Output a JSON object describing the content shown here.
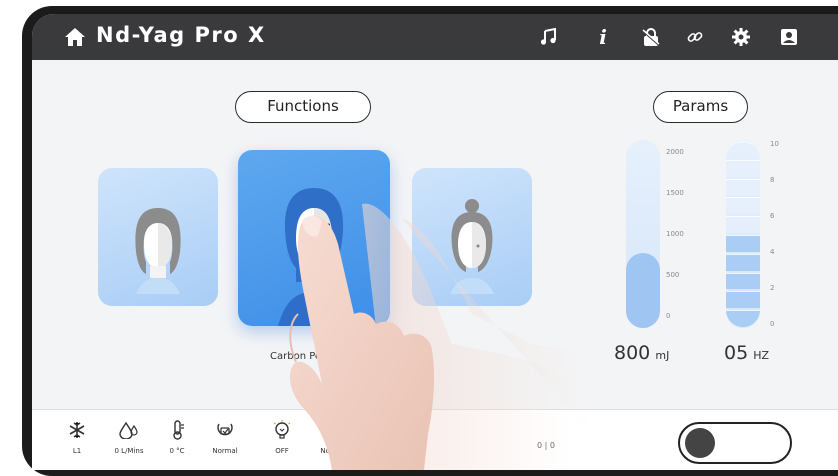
{
  "header": {
    "title": "Nd-Yag Pro X",
    "icons": [
      "home-icon",
      "music-icon",
      "info-icon",
      "lock-icon",
      "link-icon",
      "gear-icon",
      "user-icon"
    ]
  },
  "sections": {
    "functions_label": "Functions",
    "params_label": "Params"
  },
  "functions": [
    {
      "name": "face-card-1",
      "active": false
    },
    {
      "name": "carbon-peeling-card",
      "active": true,
      "label": "Carbon Peeling"
    },
    {
      "name": "face-card-3",
      "active": false
    }
  ],
  "params": {
    "energy": {
      "value": "800",
      "unit": "mJ",
      "ticks": [
        "2000",
        "1500",
        "1000",
        "500",
        "0"
      ],
      "max": 2000,
      "current": 800
    },
    "frequency": {
      "value": "05",
      "unit": "HZ",
      "ticks": [
        "10",
        "8",
        "6",
        "4",
        "2",
        "0"
      ],
      "max": 10,
      "current": 5
    }
  },
  "status": [
    {
      "icon": "snowflake-icon",
      "label": "L1"
    },
    {
      "icon": "water-drop-icon",
      "label": "0 L/Mins"
    },
    {
      "icon": "thermometer-icon",
      "label": "0 °C"
    },
    {
      "icon": "mode-icon",
      "label": "Normal"
    },
    {
      "icon": "bulb-icon",
      "label": "OFF"
    },
    {
      "icon": "mode-2-icon",
      "label": "Normal"
    }
  ],
  "counter": "0 | 0",
  "colors": {
    "titlebar": "#3a3a3c",
    "accent": "#3d8ee8",
    "card": "#cfe4fb",
    "bar": "#9fc6f3"
  }
}
